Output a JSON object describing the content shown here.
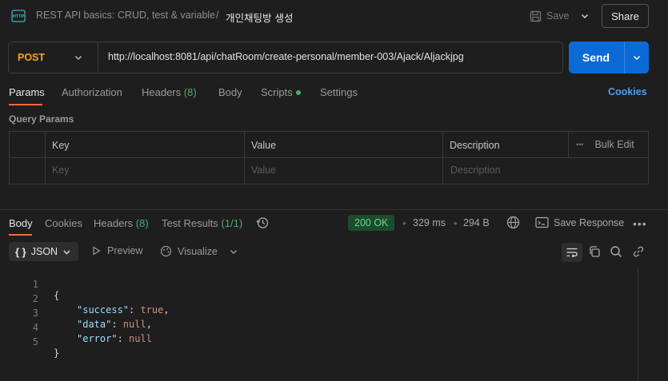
{
  "header": {
    "collection": "REST API basics: CRUD, test & variable",
    "separator": "/",
    "request_name": "개인채팅방 생성",
    "save_label": "Save",
    "share_label": "Share"
  },
  "request": {
    "method": "POST",
    "url": "http://localhost:8081/api/chatRoom/create-personal/member-003/Ajack/Aljackjpg",
    "send_label": "Send"
  },
  "request_tabs": {
    "params": "Params",
    "authorization": "Authorization",
    "headers": "Headers",
    "headers_count": "(8)",
    "body": "Body",
    "scripts": "Scripts",
    "settings": "Settings",
    "cookies": "Cookies"
  },
  "query_params": {
    "title": "Query Params",
    "columns": {
      "key": "Key",
      "value": "Value",
      "description": "Description"
    },
    "bulk_edit": "Bulk Edit",
    "more": "•••",
    "placeholders": {
      "key": "Key",
      "value": "Value",
      "description": "Description"
    }
  },
  "response_tabs": {
    "body": "Body",
    "cookies": "Cookies",
    "headers": "Headers",
    "headers_count": "(8)",
    "tests": "Test Results",
    "tests_count": "(1/1)"
  },
  "response_meta": {
    "status": "200 OK",
    "time": "329 ms",
    "size": "294 B",
    "save_response": "Save Response",
    "dot": "•",
    "more": "•••"
  },
  "response_view": {
    "format_braces": "{ }",
    "format": "JSON",
    "preview": "Preview",
    "visualize": "Visualize"
  },
  "code_lines": [
    {
      "n": "1",
      "text": "{"
    },
    {
      "n": "2",
      "key": "\"success\"",
      "sep": ": ",
      "val": "true",
      "end": ","
    },
    {
      "n": "3",
      "key": "\"data\"",
      "sep": ": ",
      "val": "null",
      "end": ","
    },
    {
      "n": "4",
      "key": "\"error\"",
      "sep": ": ",
      "val": "null",
      "end": ""
    },
    {
      "n": "5",
      "text": "}"
    }
  ],
  "colors": {
    "method": "#f5a623",
    "send": "#0b6bd6",
    "accent_underline": "#f26b3a",
    "status_bg": "#1d4b2c",
    "status_fg": "#6fd38e",
    "link": "#4e9ef3"
  },
  "icons": [
    "http-icon",
    "save-icon",
    "chevron-down-icon",
    "history-icon",
    "globe-icon",
    "save-response-icon",
    "play-icon",
    "visualize-icon",
    "wrap-icon",
    "copy-icon",
    "search-icon",
    "link-icon"
  ]
}
